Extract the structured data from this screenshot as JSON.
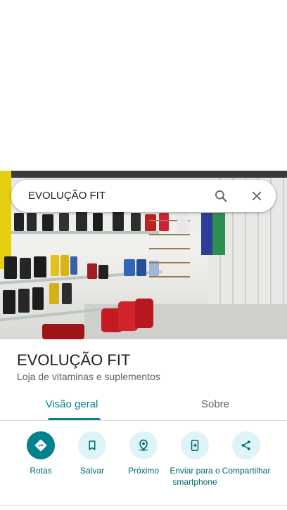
{
  "search": {
    "query": "EVOLUÇÃO FIT"
  },
  "place": {
    "name": "EVOLUÇÃO FIT",
    "category": "Loja de vitaminas e suplementos"
  },
  "tabs": [
    {
      "label": "Visão geral",
      "active": true
    },
    {
      "label": "Sobre",
      "active": false
    }
  ],
  "actions": [
    {
      "label": "Rotas",
      "icon": "directions-icon"
    },
    {
      "label": "Salvar",
      "icon": "bookmark-icon"
    },
    {
      "label": "Próximo",
      "icon": "nearby-icon"
    },
    {
      "label": "Enviar para o smartphone",
      "icon": "send-to-phone-icon"
    },
    {
      "label": "Compartilhar",
      "icon": "share-icon"
    }
  ],
  "colors": {
    "accent": "#00838f",
    "action_bg": "#def4f8",
    "action_text": "#00666e"
  }
}
